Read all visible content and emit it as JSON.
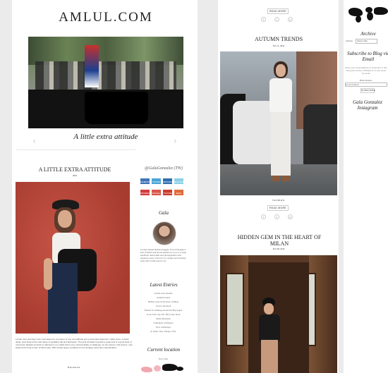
{
  "site": {
    "logo": "AMLUL.COM"
  },
  "hero": {
    "caption": "A little extra attitude"
  },
  "post1": {
    "title": "A LITTLE EXTRA ATTITUDE",
    "date": "2016",
    "excerpt": "London Fen and New York must-haves for a lot layer of one cool attitude and a grounded statement. Utility items, combat detail, wool floral of the cold range of quintillion flat and fall basics. The dark shoulder bag with a great look is a good layer of must-have attitude! And this is reflected in my outfits with a very minimal ability to challenge. As the autumn cold returns, new statements bring a color of fitted ease. With simple layers a palette of cool unhappy looks like unpredictable...",
    "category": "BAGPACK"
  },
  "sidebar1": {
    "instagram": "@GalaGonzalez (TW)",
    "social": [
      "FACEBOOK",
      "TWITTER",
      "INSTAGRAM",
      "BLOGLOVIN",
      "PINTEREST",
      "GOOGLE+",
      "YOUTUBE",
      "EMAIL"
    ],
    "about_heading": "Gala",
    "about_text": "London-based fashion blogger, DJ and designer. Fan of black and sports fashion but you in a style aesthetic. Each dark and photographer who captures every moment in a unique and timeless style with a bold point in art.",
    "latest_heading": "Latest Entries",
    "latest": [
      "A little extra attitude",
      "Autumn trends",
      "Hidden Gem in the heart of Milan",
      "Tan for the Road",
      "Mantel To Walking Around the Big Apple",
      "Look of the day NY: Have Fun, Rock",
      "Milan Moments",
      "A Moment of Balance",
      "New Challenges",
      "At home: New Village, NYC"
    ],
    "location_heading": "Current location",
    "location_value": "New York"
  },
  "middle": {
    "read_more": "READ MORE",
    "share": [
      "f",
      "t",
      "p"
    ],
    "post2_title": "AUTUMN TRENDS",
    "post2_date": "Nov 11, 2016",
    "post2_category": "FASHION",
    "post3_title": "HIDDEN GEM IN THE HEART OF MILAN",
    "post3_date": "Nov 06, 2016"
  },
  "right": {
    "archive": "Archive",
    "archive_label": "Archive",
    "archive_select": "Select date",
    "subscribe_heading": "Subscribe to Blog via Email",
    "subscribe_text": "Enter your email address to subscribe to this blog and receive notifications of new posts by email.",
    "email_label": "Email Address",
    "email_placeholder": "Email Address",
    "subscribe_btn": "SUBSCRIBE",
    "instagram_heading": "Gala Gonzalez Instagram"
  },
  "colors": {
    "accent": "#d34b3d",
    "dark": "#222222"
  }
}
